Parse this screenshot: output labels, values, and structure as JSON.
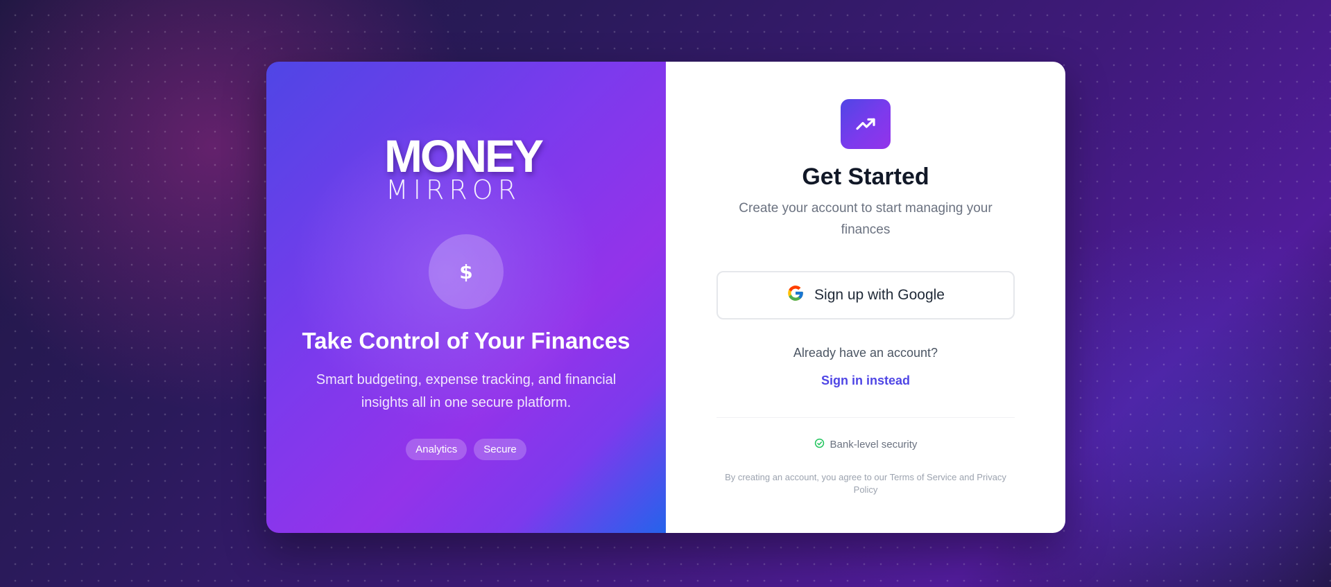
{
  "brand": {
    "logo_line1": "MONEY",
    "logo_line2": "MIRROR"
  },
  "hero": {
    "icon": "dollar-icon",
    "icon_glyph": "$",
    "headline": "Take Control of Your Finances",
    "subtitle": "Smart budgeting, expense tracking, and financial insights all in one secure platform.",
    "tags": [
      "Analytics",
      "Secure"
    ]
  },
  "signup": {
    "icon": "trending-up-icon",
    "title": "Get Started",
    "subtitle": "Create your account to start managing your finances",
    "google_button_label": "Sign up with Google",
    "already_text": "Already have an account?",
    "signin_link": "Sign in instead",
    "security_text": "Bank-level security",
    "legal_text": "By creating an account, you agree to our Terms of Service and Privacy Policy"
  },
  "colors": {
    "accent": "#4f46e5",
    "accent_purple": "#9333ea",
    "success": "#22c55e",
    "heading": "#111827",
    "muted": "#6b7280"
  }
}
